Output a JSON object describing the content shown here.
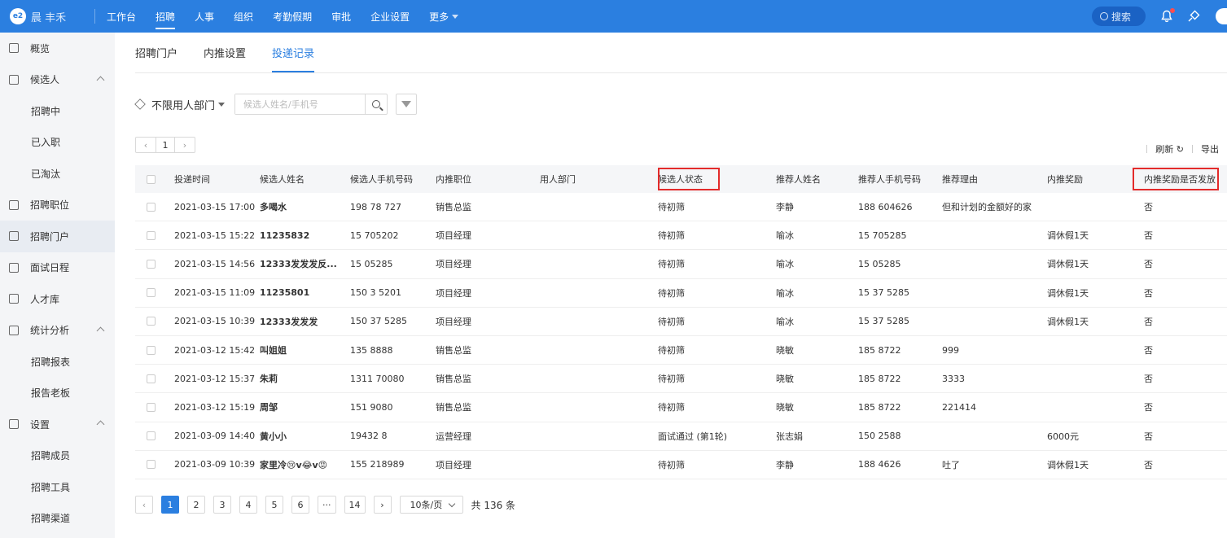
{
  "topbar": {
    "logo_mark": "e2",
    "company": "晨 丰禾",
    "nav": [
      {
        "label": "工作台",
        "active": false
      },
      {
        "label": "招聘",
        "active": true
      },
      {
        "label": "人事",
        "active": false
      },
      {
        "label": "组织",
        "active": false
      },
      {
        "label": "考勤假期",
        "active": false
      },
      {
        "label": "审批",
        "active": false
      },
      {
        "label": "企业设置",
        "active": false
      },
      {
        "label": "更多",
        "active": false
      }
    ],
    "search_label": "搜索"
  },
  "sidebar": {
    "items": [
      {
        "label": "概览",
        "type": "top"
      },
      {
        "label": "候选人",
        "type": "group"
      },
      {
        "label": "招聘中",
        "type": "sub"
      },
      {
        "label": "已入职",
        "type": "sub"
      },
      {
        "label": "已淘汰",
        "type": "sub"
      },
      {
        "label": "招聘职位",
        "type": "top"
      },
      {
        "label": "招聘门户",
        "type": "top",
        "active": true
      },
      {
        "label": "面试日程",
        "type": "top"
      },
      {
        "label": "人才库",
        "type": "top"
      },
      {
        "label": "统计分析",
        "type": "group"
      },
      {
        "label": "招聘报表",
        "type": "sub"
      },
      {
        "label": "报告老板",
        "type": "sub"
      },
      {
        "label": "设置",
        "type": "group"
      },
      {
        "label": "招聘成员",
        "type": "sub"
      },
      {
        "label": "招聘工具",
        "type": "sub"
      },
      {
        "label": "招聘渠道",
        "type": "sub"
      }
    ]
  },
  "tabs": [
    {
      "label": "招聘门户",
      "active": false
    },
    {
      "label": "内推设置",
      "active": false
    },
    {
      "label": "投递记录",
      "active": true
    }
  ],
  "filters": {
    "dept_label": "不限用人部门",
    "search_placeholder": "候选人姓名/手机号"
  },
  "mini_pager": {
    "prev": "‹",
    "page": "1",
    "next": "›"
  },
  "tools": {
    "refresh": "刷新 ↻",
    "export": "导出"
  },
  "table": {
    "columns": [
      "投递时间",
      "候选人姓名",
      "候选人手机号码",
      "内推职位",
      "用人部门",
      "候选人状态",
      "推荐人姓名",
      "推荐人手机号码",
      "推荐理由",
      "内推奖励",
      "内推奖励是否发放"
    ],
    "highlighted_columns": [
      "候选人状态",
      "内推奖励是否发放"
    ],
    "rows": [
      [
        "2021-03-15 17:00",
        "多喝水",
        "198 78 727",
        "销售总监",
        "",
        "待初筛",
        "李静",
        "188 604626",
        "但和计划的金额好的家",
        "",
        "否"
      ],
      [
        "2021-03-15 15:22",
        "11235832",
        "15 705202",
        "项目经理",
        "",
        "待初筛",
        "喻冰",
        "15 705285",
        "",
        "调休假1天",
        "否"
      ],
      [
        "2021-03-15 14:56",
        "12333发发发反...",
        "15 05285",
        "项目经理",
        "",
        "待初筛",
        "喻冰",
        "15 05285",
        "",
        "调休假1天",
        "否"
      ],
      [
        "2021-03-15 11:09",
        "11235801",
        "150 3 5201",
        "项目经理",
        "",
        "待初筛",
        "喻冰",
        "15 37 5285",
        "",
        "调休假1天",
        "否"
      ],
      [
        "2021-03-15 10:39",
        "12333发发发",
        "150 37 5285",
        "项目经理",
        "",
        "待初筛",
        "喻冰",
        "15 37 5285",
        "",
        "调休假1天",
        "否"
      ],
      [
        "2021-03-12 15:42",
        "叫姐姐",
        "135 8888",
        "销售总监",
        "",
        "待初筛",
        "晓敏",
        "185 8722",
        "999",
        "",
        "否"
      ],
      [
        "2021-03-12 15:37",
        "朱莉",
        "1311 70080",
        "销售总监",
        "",
        "待初筛",
        "晓敏",
        "185 8722",
        "3333",
        "",
        "否"
      ],
      [
        "2021-03-12 15:19",
        "周邹",
        "151 9080",
        "销售总监",
        "",
        "待初筛",
        "晓敏",
        "185 8722",
        "221414",
        "",
        "否"
      ],
      [
        "2021-03-09 14:40",
        "黄小小",
        "19432 8",
        "运营经理",
        "",
        "面试通过 (第1轮)",
        "张志娟",
        "150 2588",
        "",
        "6000元",
        "否"
      ],
      [
        "2021-03-09 10:39",
        "家里冷😢v😂v😡",
        "155 218989",
        "项目经理",
        "",
        "待初筛",
        "李静",
        "188 4626",
        "吐了",
        "调休假1天",
        "否"
      ]
    ]
  },
  "pagination": {
    "pages": [
      "1",
      "2",
      "3",
      "4",
      "5",
      "6",
      "···",
      "14"
    ],
    "current": "1",
    "prev": "‹",
    "next": "›",
    "page_size": "10条/页",
    "total": "共 136 条"
  },
  "colors": {
    "primary": "#2b7fe0",
    "highlight": "#e32b2b"
  }
}
